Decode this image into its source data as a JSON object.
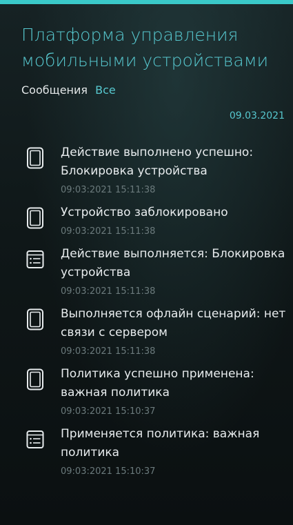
{
  "header": {
    "title": "Платформа управления мобильными устройствами",
    "messages_label": "Сообщения",
    "filter_label": "Все",
    "date": "09.03.2021"
  },
  "notifications": [
    {
      "icon": "device-icon",
      "text": "Действие выполнено успешно: Блокировка устройства",
      "time": "09:03:2021 15:11:38"
    },
    {
      "icon": "device-icon",
      "text": "Устройство заблокировано",
      "time": "09:03:2021 15:11:38"
    },
    {
      "icon": "list-icon",
      "text": "Действие выполняется: Блокировка устройства",
      "time": "09:03:2021 15:11:38"
    },
    {
      "icon": "device-icon",
      "text": "Выполняется офлайн сценарий: нет связи с сервером",
      "time": "09:03:2021 15:11:38"
    },
    {
      "icon": "device-icon",
      "text": "Политика успешно применена: важная политика",
      "time": "09:03:2021 15:10:37"
    },
    {
      "icon": "list-icon",
      "text": "Применяется политика: важная политика",
      "time": "09:03:2021 15:10:37"
    }
  ]
}
